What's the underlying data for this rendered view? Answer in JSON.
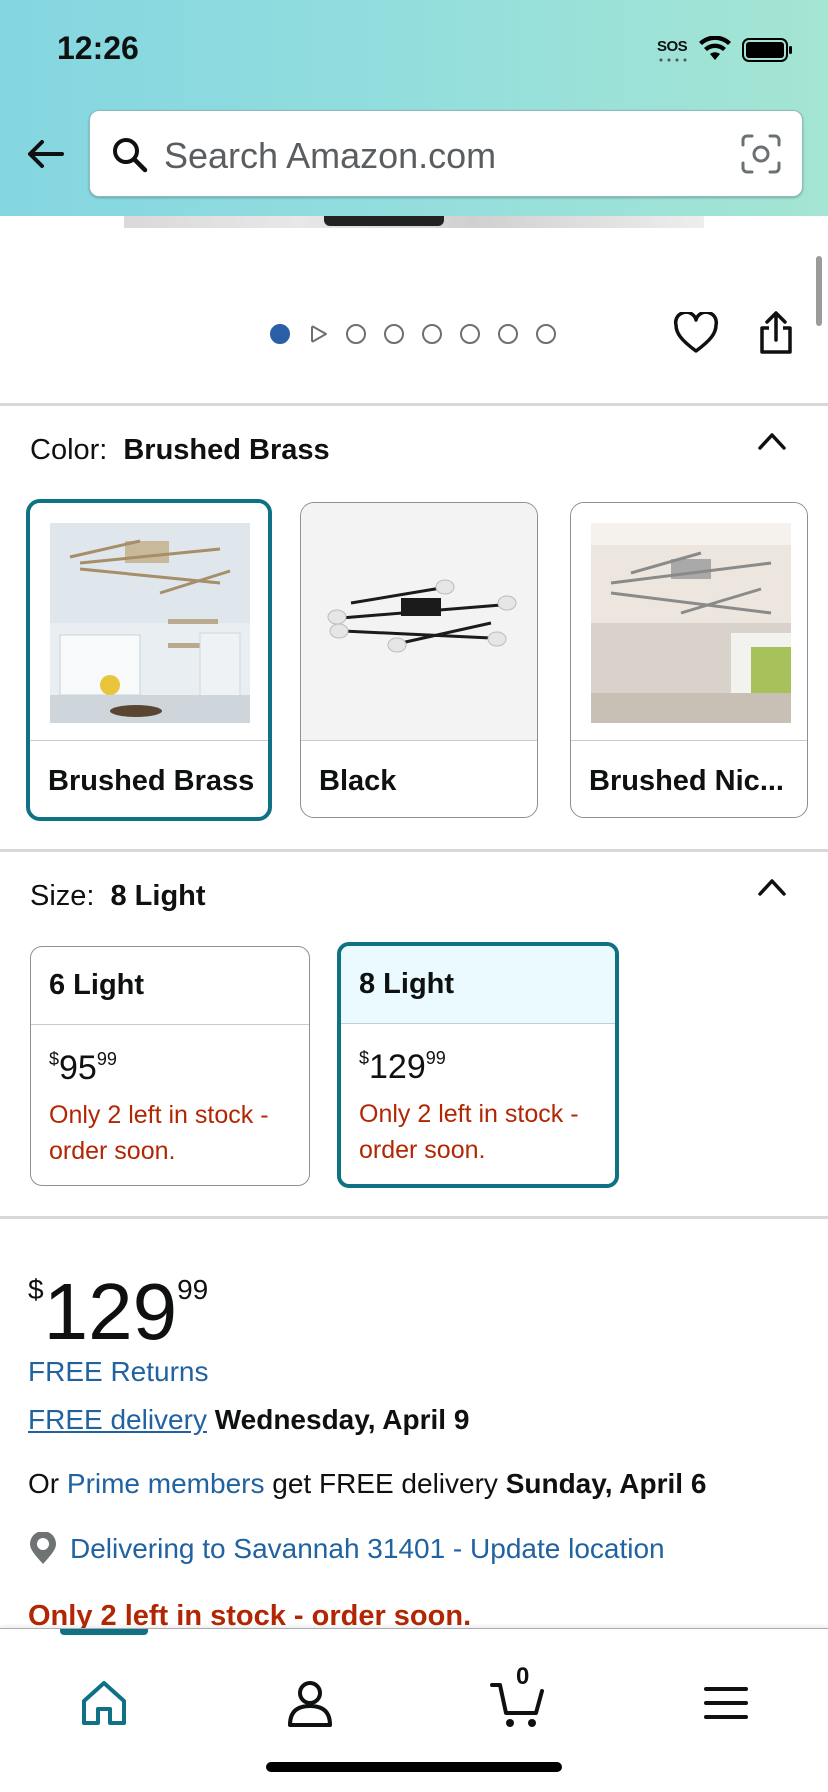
{
  "status_bar": {
    "time": "12:26",
    "sos": "SOS"
  },
  "search": {
    "placeholder": "Search Amazon.com"
  },
  "gallery": {
    "total_dots": 8,
    "active_index": 0
  },
  "color": {
    "label": "Color:",
    "selected": "Brushed Brass",
    "options": [
      {
        "name": "Brushed Brass",
        "selected": true
      },
      {
        "name": "Black",
        "selected": false
      },
      {
        "name": "Brushed Nic...",
        "selected": false
      }
    ]
  },
  "size": {
    "label": "Size:",
    "selected": "8 Light",
    "options": [
      {
        "name": "6 Light",
        "price_whole": "95",
        "price_frac": "99",
        "currency": "$",
        "stock": "Only 2 left in stock - order soon.",
        "selected": false
      },
      {
        "name": "8 Light",
        "price_whole": "129",
        "price_frac": "99",
        "currency": "$",
        "stock": "Only 2 left in stock - order soon.",
        "selected": true
      }
    ]
  },
  "price": {
    "currency": "$",
    "whole": "129",
    "fraction": "99"
  },
  "shipping": {
    "returns": "FREE Returns",
    "delivery_link": "FREE delivery",
    "delivery_date": "Wednesday, April 9",
    "prime_prefix": "Or",
    "prime_link": "Prime members",
    "prime_middle": "get FREE delivery",
    "prime_date": "Sunday, April 6",
    "location": "Delivering to Savannah 31401 - Update location"
  },
  "stock_warning": "Only 2 left in stock - order soon.",
  "bottom_nav": {
    "cart_count": "0"
  },
  "colors": {
    "accent": "#0e7184",
    "link": "#2162a1",
    "warning": "#b12704"
  }
}
